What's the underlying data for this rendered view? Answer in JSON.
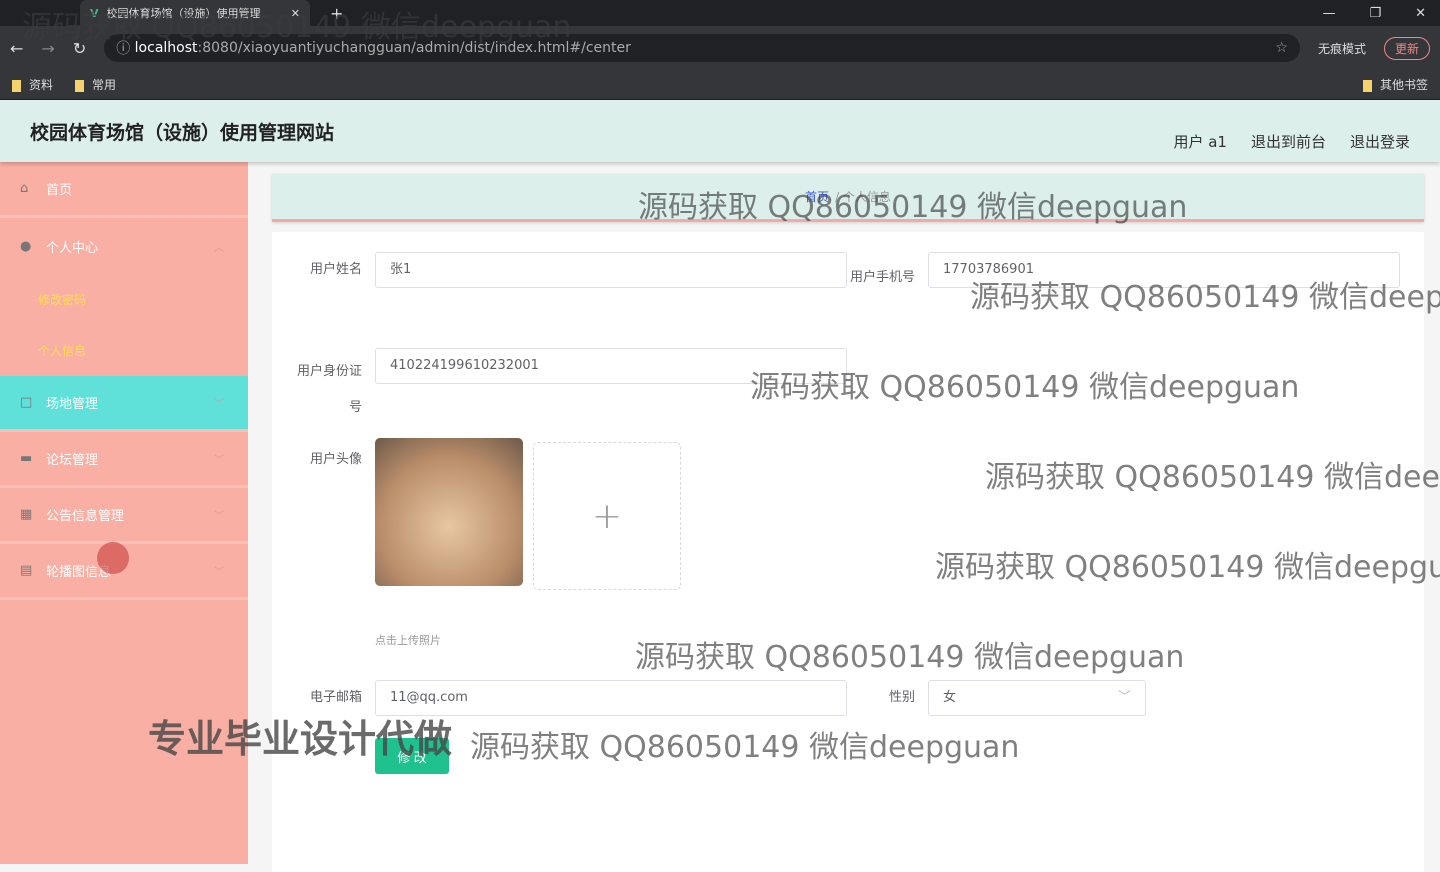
{
  "browser": {
    "tab_title": "校园体育场馆（设施）使用管理",
    "url_host": "localhost",
    "url_rest": ":8080/xiaoyuantiyuchangguan/admin/dist/index.html#/center",
    "incognito": "无痕模式",
    "update": "更新",
    "bookmarks": [
      "资料",
      "常用"
    ],
    "other_bookmarks": "其他书签"
  },
  "header": {
    "title": "校园体育场馆（设施）使用管理网站",
    "user": "用户 a1",
    "to_front": "退出到前台",
    "logout": "退出登录"
  },
  "sidebar": {
    "items": [
      {
        "label": "首页",
        "icon": "home-icon"
      },
      {
        "label": "个人中心",
        "icon": "user-icon"
      },
      {
        "label": "场地管理",
        "icon": "square-icon"
      },
      {
        "label": "论坛管理",
        "icon": "briefcase-icon"
      },
      {
        "label": "公告信息管理",
        "icon": "grid-icon"
      },
      {
        "label": "轮播图信息",
        "icon": "clipboard-icon"
      }
    ],
    "sub": [
      "修改密码",
      "个人信息"
    ]
  },
  "breadcrumb": {
    "home": "首页",
    "current": "个人信息"
  },
  "form": {
    "name_label": "用户姓名",
    "name": "张1",
    "phone_label": "用户手机号",
    "phone": "17703786901",
    "id_label": "用户身份证号",
    "id": "410224199610232001",
    "avatar_label": "用户头像",
    "upload_hint": "点击上传照片",
    "email_label": "电子邮箱",
    "email": "11@qq.com",
    "gender_label": "性别",
    "gender": "女",
    "submit": "修 改"
  },
  "watermark": {
    "text": "源码获取 QQ86050149 微信deepguan",
    "ad": "专业毕业设计代做"
  }
}
